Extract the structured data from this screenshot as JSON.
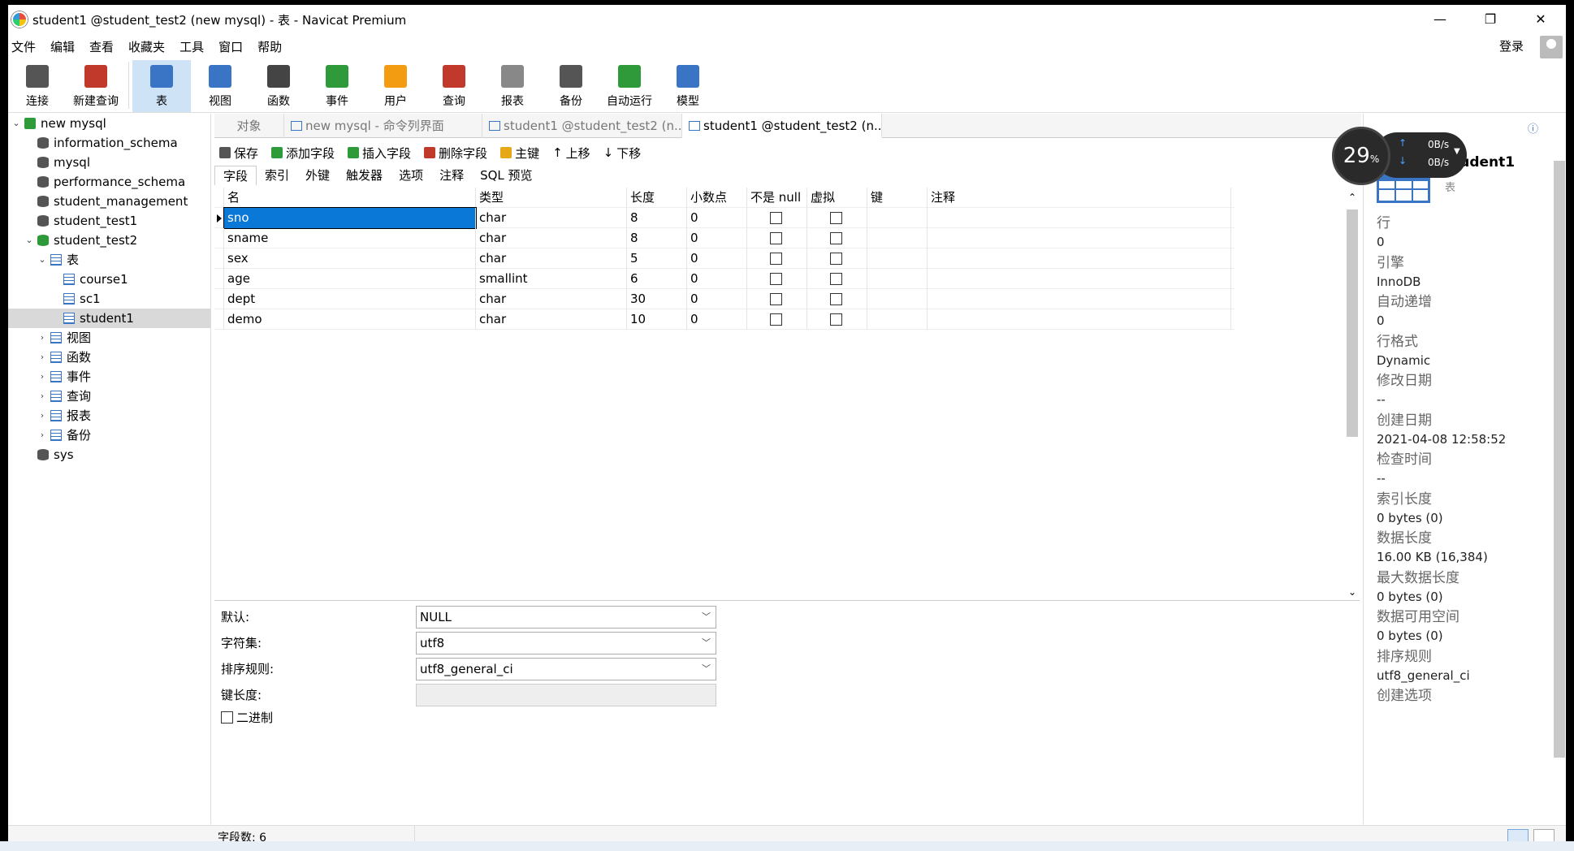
{
  "window": {
    "title": "student1 @student_test2 (new mysql) - 表 - Navicat Premium",
    "min": "—",
    "max": "❐",
    "close": "✕"
  },
  "menu": [
    "文件",
    "编辑",
    "查看",
    "收藏夹",
    "工具",
    "窗口",
    "帮助"
  ],
  "login": "登录",
  "toolbar": [
    {
      "label": "连接",
      "icon": "connection-icon",
      "color": "#555"
    },
    {
      "label": "新建查询",
      "icon": "new-query-icon",
      "color": "#c0392b"
    },
    {
      "label": "表",
      "icon": "table-icon",
      "color": "#3a74c4"
    },
    {
      "label": "视图",
      "icon": "view-icon",
      "color": "#3a74c4"
    },
    {
      "label": "函数",
      "icon": "function-icon",
      "color": "#444"
    },
    {
      "label": "事件",
      "icon": "event-clock-icon",
      "color": "#2e9a3a"
    },
    {
      "label": "用户",
      "icon": "user-icon",
      "color": "#f39c12"
    },
    {
      "label": "查询",
      "icon": "query-icon",
      "color": "#c0392b"
    },
    {
      "label": "报表",
      "icon": "report-icon",
      "color": "#888"
    },
    {
      "label": "备份",
      "icon": "backup-icon",
      "color": "#555"
    },
    {
      "label": "自动运行",
      "icon": "automation-icon",
      "color": "#2e9a3a"
    },
    {
      "label": "模型",
      "icon": "model-icon",
      "color": "#3a74c4"
    }
  ],
  "tree": [
    {
      "label": "new mysql",
      "level": 0,
      "expanded": true,
      "icon": "connection-icon"
    },
    {
      "label": "information_schema",
      "level": 1,
      "icon": "database-icon"
    },
    {
      "label": "mysql",
      "level": 1,
      "icon": "database-icon"
    },
    {
      "label": "performance_schema",
      "level": 1,
      "icon": "database-icon"
    },
    {
      "label": "student_management",
      "level": 1,
      "icon": "database-icon"
    },
    {
      "label": "student_test1",
      "level": 1,
      "icon": "database-icon"
    },
    {
      "label": "student_test2",
      "level": 1,
      "expanded": true,
      "icon": "database-open-icon"
    },
    {
      "label": "表",
      "level": 2,
      "expanded": true,
      "icon": "table-folder-icon"
    },
    {
      "label": "course1",
      "level": 3,
      "icon": "table-icon"
    },
    {
      "label": "sc1",
      "level": 3,
      "icon": "table-icon"
    },
    {
      "label": "student1",
      "level": 3,
      "icon": "table-icon",
      "selected": true
    },
    {
      "label": "视图",
      "level": 2,
      "collapsed": true,
      "icon": "view-icon"
    },
    {
      "label": "函数",
      "level": 2,
      "collapsed": true,
      "icon": "function-icon"
    },
    {
      "label": "事件",
      "level": 2,
      "collapsed": true,
      "icon": "event-icon"
    },
    {
      "label": "查询",
      "level": 2,
      "collapsed": true,
      "icon": "query-icon"
    },
    {
      "label": "报表",
      "level": 2,
      "collapsed": true,
      "icon": "report-icon"
    },
    {
      "label": "备份",
      "level": 2,
      "collapsed": true,
      "icon": "backup-icon"
    },
    {
      "label": "sys",
      "level": 1,
      "icon": "database-icon"
    }
  ],
  "tabs": {
    "objects": "对象",
    "t1": "new mysql - 命令列界面",
    "t2": "student1 @student_test2 (n...",
    "t3": "student1 @student_test2 (n..."
  },
  "actions": [
    "保存",
    "添加字段",
    "插入字段",
    "删除字段",
    "主键",
    "上移",
    "下移"
  ],
  "subtabs": [
    "字段",
    "索引",
    "外键",
    "触发器",
    "选项",
    "注释",
    "SQL 预览"
  ],
  "columns": [
    "名",
    "类型",
    "长度",
    "小数点",
    "不是 null",
    "虚拟",
    "键",
    "注释"
  ],
  "fields": [
    {
      "name": "sno",
      "type": "char",
      "length": "8",
      "decimals": "0"
    },
    {
      "name": "sname",
      "type": "char",
      "length": "8",
      "decimals": "0"
    },
    {
      "name": "sex",
      "type": "char",
      "length": "5",
      "decimals": "0"
    },
    {
      "name": "age",
      "type": "smallint",
      "length": "6",
      "decimals": "0"
    },
    {
      "name": "dept",
      "type": "char",
      "length": "30",
      "decimals": "0"
    },
    {
      "name": "demo",
      "type": "char",
      "length": "10",
      "decimals": "0"
    }
  ],
  "props": {
    "default_label": "默认:",
    "default_value": "NULL",
    "charset_label": "字符集:",
    "charset_value": "utf8",
    "collation_label": "排序规则:",
    "collation_value": "utf8_general_ci",
    "keylen_label": "键长度:",
    "binary_label": "二进制"
  },
  "status": {
    "field_count": "字段数: 6"
  },
  "info": {
    "name": "student1",
    "type": "表",
    "items": [
      {
        "k": "行",
        "v": "0"
      },
      {
        "k": "引擎",
        "v": "InnoDB"
      },
      {
        "k": "自动递增",
        "v": "0"
      },
      {
        "k": "行格式",
        "v": "Dynamic"
      },
      {
        "k": "修改日期",
        "v": "--"
      },
      {
        "k": "创建日期",
        "v": "2021-04-08 12:58:52"
      },
      {
        "k": "检查时间",
        "v": "--"
      },
      {
        "k": "索引长度",
        "v": "0 bytes (0)"
      },
      {
        "k": "数据长度",
        "v": "16.00 KB (16,384)"
      },
      {
        "k": "最大数据长度",
        "v": "0 bytes (0)"
      },
      {
        "k": "数据可用空间",
        "v": "0 bytes (0)"
      },
      {
        "k": "排序规则",
        "v": "utf8_general_ci"
      },
      {
        "k": "创建选项",
        "v": ""
      }
    ]
  },
  "widget": {
    "percent": "29",
    "unit": "%",
    "up": "0B/s",
    "down": "0B/s"
  }
}
